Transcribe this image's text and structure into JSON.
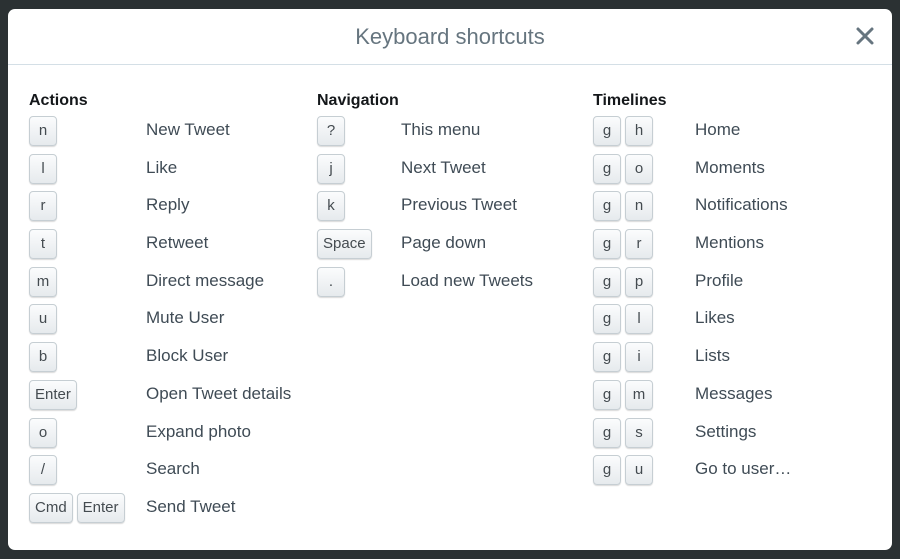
{
  "modal": {
    "title": "Keyboard shortcuts",
    "close_icon": "close-icon"
  },
  "sections": {
    "actions": {
      "title": "Actions",
      "items": [
        {
          "keys": [
            "n"
          ],
          "label": "New Tweet"
        },
        {
          "keys": [
            "l"
          ],
          "label": "Like"
        },
        {
          "keys": [
            "r"
          ],
          "label": "Reply"
        },
        {
          "keys": [
            "t"
          ],
          "label": "Retweet"
        },
        {
          "keys": [
            "m"
          ],
          "label": "Direct message"
        },
        {
          "keys": [
            "u"
          ],
          "label": "Mute User"
        },
        {
          "keys": [
            "b"
          ],
          "label": "Block User"
        },
        {
          "keys": [
            "Enter"
          ],
          "label": "Open Tweet details"
        },
        {
          "keys": [
            "o"
          ],
          "label": "Expand photo"
        },
        {
          "keys": [
            "/"
          ],
          "label": "Search"
        },
        {
          "keys": [
            "Cmd",
            "Enter"
          ],
          "label": "Send Tweet"
        }
      ]
    },
    "navigation": {
      "title": "Navigation",
      "items": [
        {
          "keys": [
            "?"
          ],
          "label": "This menu"
        },
        {
          "keys": [
            "j"
          ],
          "label": "Next Tweet"
        },
        {
          "keys": [
            "k"
          ],
          "label": "Previous Tweet"
        },
        {
          "keys": [
            "Space"
          ],
          "label": "Page down"
        },
        {
          "keys": [
            "."
          ],
          "label": "Load new Tweets"
        }
      ]
    },
    "timelines": {
      "title": "Timelines",
      "items": [
        {
          "keys": [
            "g",
            "h"
          ],
          "label": "Home"
        },
        {
          "keys": [
            "g",
            "o"
          ],
          "label": "Moments"
        },
        {
          "keys": [
            "g",
            "n"
          ],
          "label": "Notifications"
        },
        {
          "keys": [
            "g",
            "r"
          ],
          "label": "Mentions"
        },
        {
          "keys": [
            "g",
            "p"
          ],
          "label": "Profile"
        },
        {
          "keys": [
            "g",
            "l"
          ],
          "label": "Likes"
        },
        {
          "keys": [
            "g",
            "i"
          ],
          "label": "Lists"
        },
        {
          "keys": [
            "g",
            "m"
          ],
          "label": "Messages"
        },
        {
          "keys": [
            "g",
            "s"
          ],
          "label": "Settings"
        },
        {
          "keys": [
            "g",
            "u"
          ],
          "label": "Go to user…"
        }
      ]
    }
  }
}
